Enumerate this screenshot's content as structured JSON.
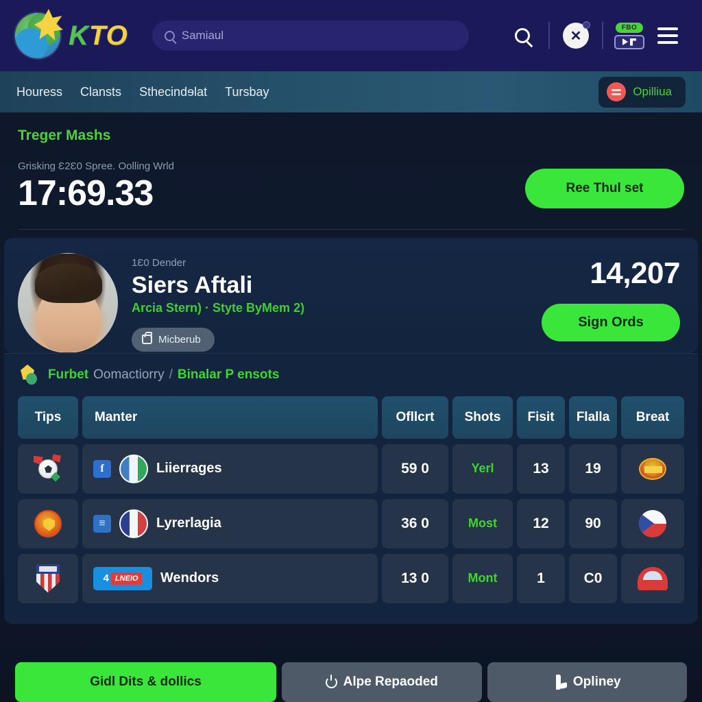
{
  "topbar": {
    "brand": {
      "k": "K",
      "t": "T",
      "o": "O"
    },
    "search": {
      "value": "Samiaul",
      "placeholder": "Samiaul"
    },
    "actions": {
      "search_label": "search-icon",
      "avatar_label": "X",
      "promo_badge": "FBO",
      "menu_label": "menu-icon"
    }
  },
  "nav": {
    "items": [
      {
        "label": "Houress"
      },
      {
        "label": "Clansts"
      },
      {
        "label": "Sthecindɘlat"
      },
      {
        "label": "Tursbay"
      }
    ],
    "cta": {
      "label": "Opilliua"
    }
  },
  "timer": {
    "title": "Treger Mashs",
    "subtitle": "Grisking Ɛ2Ɛ0 Spree. Oolling Wrld",
    "value": "17:69.33",
    "button": "Ree Thul set"
  },
  "player": {
    "eyebrow": "1Ɛ0 Dender",
    "name": "Siers Aftali",
    "meta": "Arcia Stern) · Styte ByMem 2)",
    "chip": "Micberub",
    "score": "14,207",
    "button": "Sign Ords"
  },
  "breadcrumb": {
    "primary": "Furbet",
    "primary_tail": "Oomactiorry",
    "separator": "/",
    "secondary": "Binalar P ensots"
  },
  "table": {
    "headers": [
      "Tips",
      "Manter",
      "Ofllcrt",
      "Shots",
      "Fisit",
      "Flalla",
      "Breat"
    ],
    "rows": [
      {
        "tips_icon": "football-cards-icon",
        "badge_text": "f",
        "flag": "flag-hu",
        "name": "Liierrages",
        "ofllcrt": "59 0",
        "shots": "Yerl",
        "fisit": "13",
        "flalla": "19",
        "breat_icon": "gold-crest-icon"
      },
      {
        "tips_icon": "manchester-crest-icon",
        "badge_text": "≡",
        "flag": "flag-fr",
        "name": "Lyrerlagia",
        "ofllcrt": "36 0",
        "shots": "Most",
        "fisit": "12",
        "flalla": "90",
        "breat_icon": "czech-flag-icon"
      },
      {
        "tips_icon": "striped-shield-icon",
        "badge_text": "4",
        "badge_sub": "LNEIO",
        "flag": "",
        "name": "Wendors",
        "ofllcrt": "13 0",
        "shots": "Mont",
        "fisit": "1",
        "flalla": "C0",
        "breat_icon": "red-car-icon"
      }
    ]
  },
  "bottombar": {
    "primary": "Gidl Dits & dollics",
    "secondary": "Alpe Repaoded",
    "tertiary": "Opliney"
  },
  "colors": {
    "accent_green": "#3ae63a",
    "brand_navy": "#1b1a58",
    "nav_teal": "#255069",
    "card_navy": "#13243e",
    "cta_red": "#ef5b54"
  }
}
